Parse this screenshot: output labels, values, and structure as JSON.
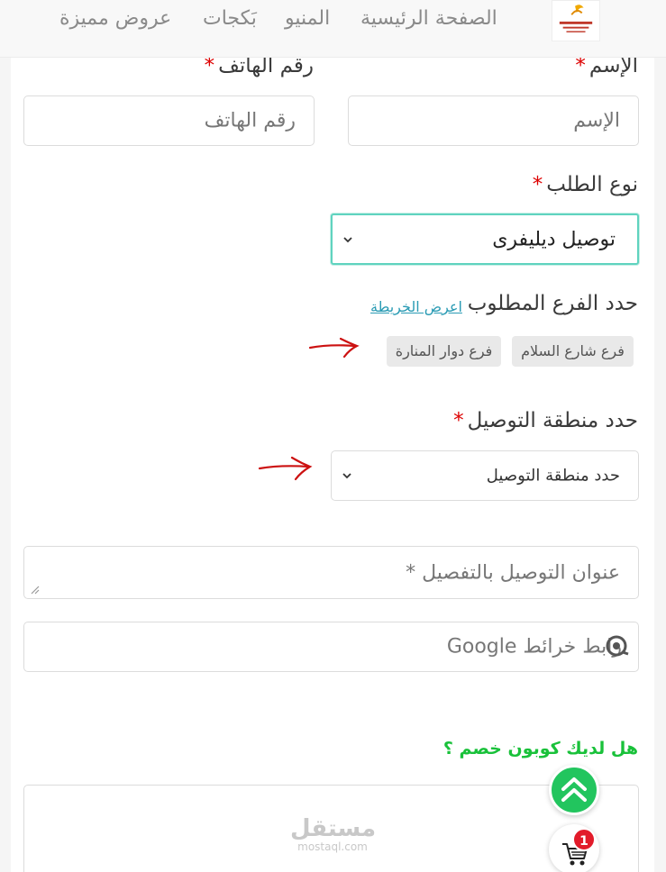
{
  "nav": {
    "home": "الصفحة الرئيسية",
    "menu": "المنيو",
    "packages": "بَكجات",
    "offers": "عروض مميزة"
  },
  "form": {
    "required_mark": "*",
    "name": {
      "label": "الإسم",
      "placeholder": "الإسم"
    },
    "phone": {
      "label": "رقم الهاتف",
      "placeholder": "رقم الهاتف"
    },
    "order_type": {
      "label": "نوع الطلب",
      "selected": "توصيل ديليفرى"
    },
    "branch": {
      "label": "حدد الفرع المطلوب",
      "map_link": "اعرض الخريطة",
      "options": [
        "فرع شارع السلام",
        "فرع دوار المنارة"
      ]
    },
    "zone": {
      "label": "حدد منطقة التوصيل",
      "selected": "حدد منطقة التوصيل"
    },
    "address": {
      "placeholder": "عنوان التوصيل بالتفصيل *"
    },
    "maps_link": {
      "placeholder": "رابط خرائط Google"
    },
    "coupon": {
      "question": "هل لديك كوبون خصم ؟"
    }
  },
  "watermark": {
    "arabic": "مستقل",
    "latin": "mostaql.com"
  },
  "cart": {
    "count": "1"
  },
  "colors": {
    "accent_teal": "#5fd3bf",
    "link": "#2a9bb4",
    "required": "#dd0000",
    "coupon_green": "#19c13a",
    "fab_green": "#22c55e",
    "badge_red": "#e21b2a",
    "annotation_red": "#cc1111"
  },
  "icons": {
    "select_arrow": "chevron-down-icon",
    "map_pin": "location-pin-icon",
    "scroll_top": "double-chevron-up-icon",
    "cart": "shopping-cart-icon",
    "annotation": "hand-drawn-arrow-icon"
  }
}
